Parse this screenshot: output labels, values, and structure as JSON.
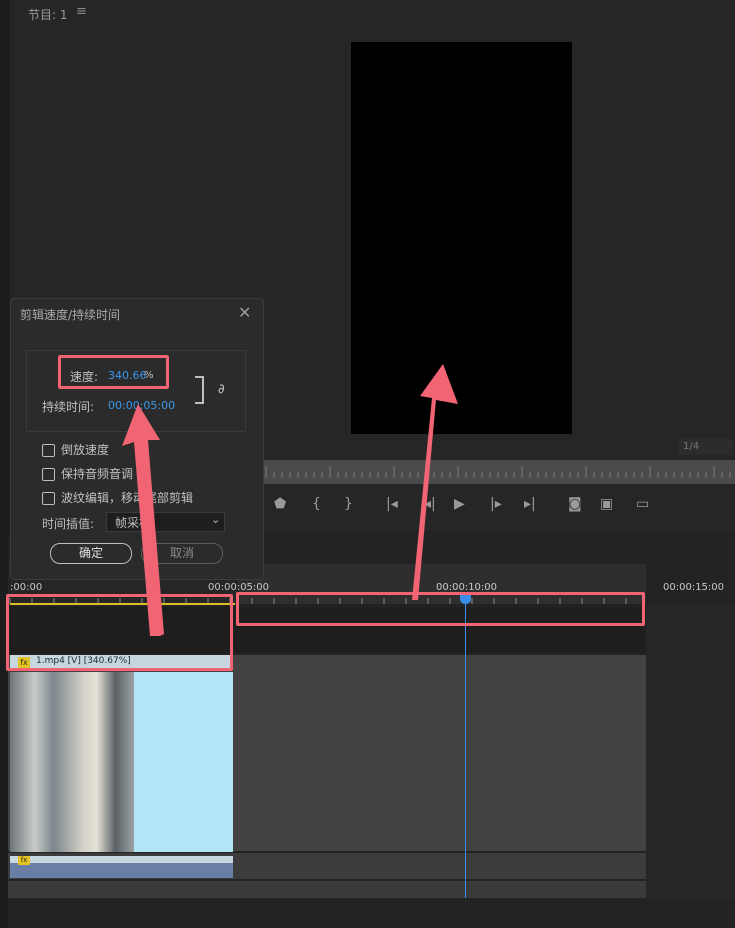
{
  "program_monitor": {
    "title": "节目: 1",
    "menu_icon": "hamburger-icon",
    "zoom": "1/4"
  },
  "dialog": {
    "title": "剪辑速度/持续时间",
    "speed_label": "速度:",
    "speed_value": "340.66",
    "speed_unit": "%",
    "duration_label": "持续时间:",
    "duration_value": "00:00:05:00",
    "reverse_speed": "倒放速度",
    "maintain_pitch": "保持音频音调",
    "ripple_edit": "波纹编辑，移动尾部剪辑",
    "interp_label": "时间插值:",
    "interp_value": "帧采样",
    "ok": "确定",
    "cancel": "取消"
  },
  "timeline": {
    "timecodes": [
      ":00:00",
      "00:00:05:00",
      "00:00:10:00",
      "00:00:15:00"
    ],
    "video_clip_label": "1.mp4 [V] [340.67%]",
    "fx": "fx",
    "playhead_color": "#3a8eea"
  },
  "annotation_color": "#f06473"
}
